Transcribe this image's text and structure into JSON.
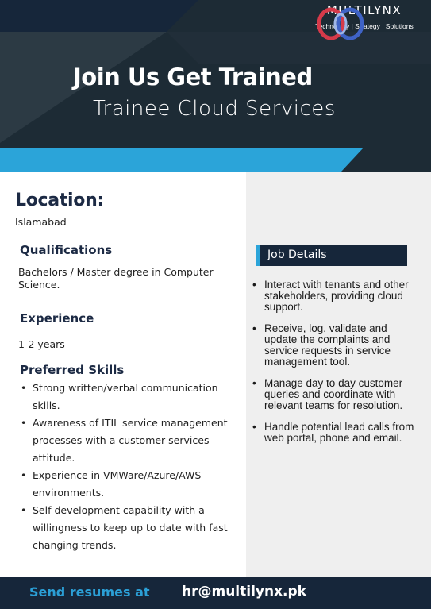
{
  "brand": {
    "name": "MULTILYNX",
    "tagline": "Technology | Strategy | Solutions"
  },
  "hero": {
    "title": "Join Us Get Trained",
    "subtitle": "Trainee Cloud Services"
  },
  "location": {
    "heading": "Location:",
    "value": "Islamabad"
  },
  "qualifications": {
    "heading": "Qualifications",
    "text": "Bachelors / Master degree in Computer Science."
  },
  "experience": {
    "heading": "Experience",
    "text": "1-2 years"
  },
  "preferred_skills": {
    "heading": "Preferred Skills",
    "items": [
      "Strong written/verbal communication skills.",
      "Awareness of ITIL service management processes with a customer services attitude.",
      "Experience in VMWare/Azure/AWS environments.",
      "Self development capability with a willingness to keep up to date with fast changing trends."
    ]
  },
  "job_details": {
    "heading": "Job Details",
    "items": [
      "Interact with tenants and other stakeholders, providing cloud support.",
      "Receive, log, validate and update the complaints and service requests in service management tool.",
      "Manage day to day customer queries and coordinate with relevant teams for resolution.",
      "Handle potential lead calls from web portal, phone and email."
    ]
  },
  "footer": {
    "label": "Send resumes at",
    "email": "hr@multilynx.pk"
  },
  "colors": {
    "navy": "#16263a",
    "dark_slate": "#1d2b35",
    "accent_blue": "#2ba4d9",
    "heading_blue": "#1c2a44",
    "panel_gray": "#efefef"
  }
}
